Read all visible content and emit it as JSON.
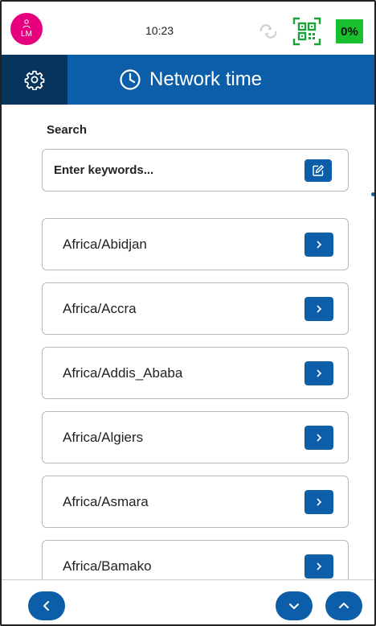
{
  "status_bar": {
    "avatar_initials": "LM",
    "time": "10:23",
    "battery": "0%",
    "icons": [
      "user-icon",
      "sync-icon",
      "qr-code-icon"
    ]
  },
  "header": {
    "settings_icon": "gear-icon",
    "title_icon": "clock-icon",
    "title": "Network time"
  },
  "search": {
    "label": "Search",
    "placeholder": "Enter keywords...",
    "value": "",
    "button_icon": "edit-icon"
  },
  "timezones": [
    {
      "label": "Africa/Abidjan"
    },
    {
      "label": "Africa/Accra"
    },
    {
      "label": "Africa/Addis_Ababa"
    },
    {
      "label": "Africa/Algiers"
    },
    {
      "label": "Africa/Asmara"
    },
    {
      "label": "Africa/Bamako"
    }
  ],
  "footer": {
    "back_icon": "chevron-left-icon",
    "down_icon": "chevron-down-icon",
    "up_icon": "chevron-up-icon"
  },
  "colors": {
    "primary": "#0c5ea8",
    "primary_dark": "#07345c",
    "avatar": "#e6007e",
    "battery": "#19c02f",
    "qr_icon": "#19a33a"
  }
}
